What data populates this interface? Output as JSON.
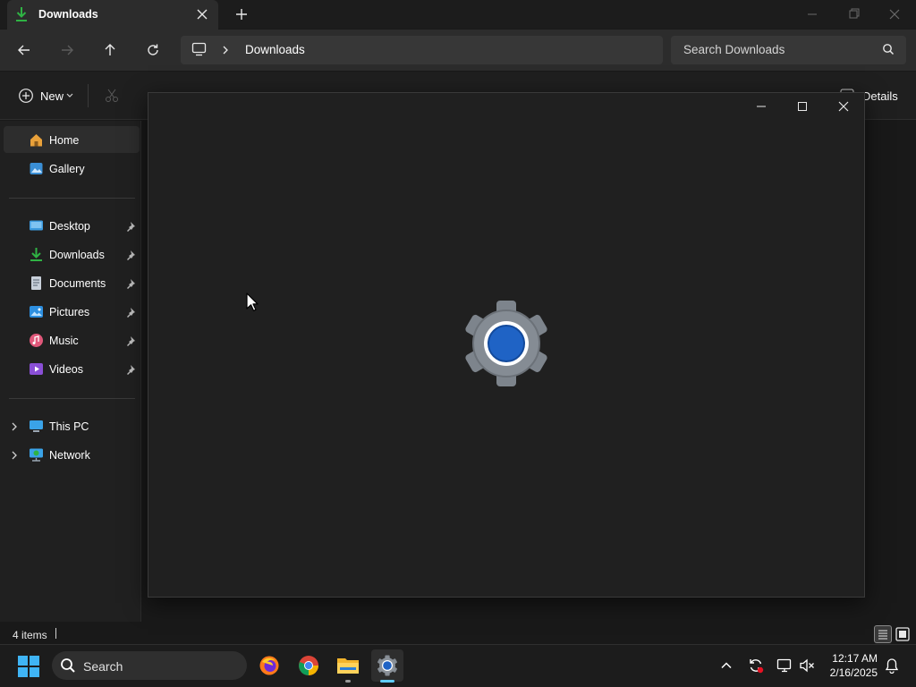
{
  "window": {
    "tab_title": "Downloads",
    "tab_icon": "download-icon",
    "new_tab_icon": "plus-icon"
  },
  "nav": {
    "address_path": "Downloads",
    "search_placeholder": "Search Downloads",
    "icons": [
      "back-arrow-icon",
      "forward-arrow-icon",
      "up-arrow-icon",
      "refresh-icon",
      "monitor-icon",
      "chevron-right-icon",
      "search-icon"
    ]
  },
  "commandbar": {
    "new_label": "New",
    "details_label": "Details"
  },
  "sidebar": {
    "items": [
      {
        "label": "Home",
        "icon": "home-icon",
        "selected": true
      },
      {
        "label": "Gallery",
        "icon": "gallery-icon"
      },
      {
        "label": "Desktop",
        "icon": "desktop-icon",
        "pinned": true
      },
      {
        "label": "Downloads",
        "icon": "download-icon",
        "pinned": true
      },
      {
        "label": "Documents",
        "icon": "documents-icon",
        "pinned": true
      },
      {
        "label": "Pictures",
        "icon": "pictures-icon",
        "pinned": true
      },
      {
        "label": "Music",
        "icon": "music-icon",
        "pinned": true
      },
      {
        "label": "Videos",
        "icon": "videos-icon",
        "pinned": true
      },
      {
        "label": "This PC",
        "icon": "this-pc-icon",
        "expandable": true
      },
      {
        "label": "Network",
        "icon": "network-icon",
        "expandable": true
      }
    ]
  },
  "status": {
    "items_count": "4 items"
  },
  "dialog": {
    "icon": "settings-gear-icon",
    "controls": [
      "minimize-icon",
      "maximize-icon",
      "close-icon"
    ]
  },
  "taskbar": {
    "search_label": "Search",
    "apps": [
      "firefox-icon",
      "chrome-icon",
      "file-explorer-icon",
      "settings-icon"
    ],
    "tray_icons": [
      "chevron-up-icon",
      "sync-icon",
      "display-icon",
      "volume-muted-icon",
      "notification-bell-icon"
    ],
    "time": "12:17 AM",
    "date": "2/16/2025"
  },
  "colors": {
    "accent": "#60cdff",
    "download_green": "#2fb344",
    "gear_blue": "#1f63c5"
  }
}
